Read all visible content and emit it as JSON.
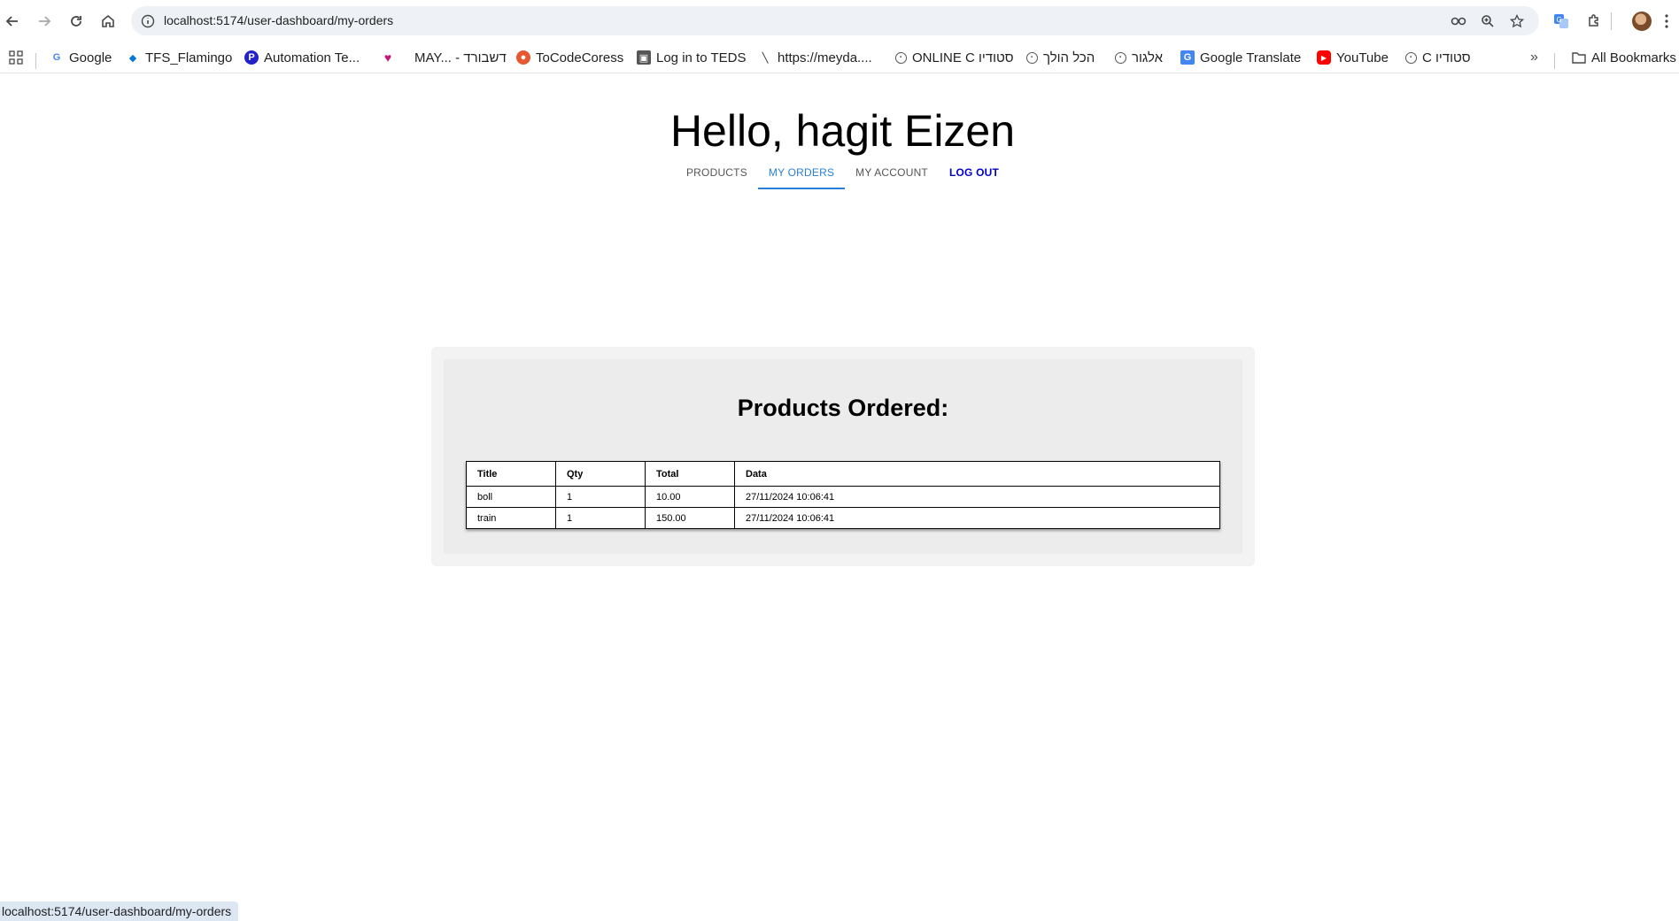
{
  "browser": {
    "url": "localhost:5174/user-dashboard/my-orders",
    "bookmarks": [
      {
        "label": "Google",
        "icon": "google-icon",
        "color": "#4285f4"
      },
      {
        "label": "TFS_Flamingo",
        "icon": "azure-devops-icon",
        "color": "#0078d4"
      },
      {
        "label": "Automation Te...",
        "icon": "p-icon",
        "color": "#2222cc"
      },
      {
        "label": "MAY... - דשבורד",
        "icon": "heart-icon",
        "color": "#c2187a"
      },
      {
        "label": "ToCodeCoress",
        "icon": "tocode-icon",
        "color": "#e8572f"
      },
      {
        "label": "Log in to TEDS",
        "icon": "teds-icon",
        "color": "#555555"
      },
      {
        "label": "https://meyda....",
        "icon": "meyda-icon",
        "color": "#222222"
      },
      {
        "label": "ONLINE C סטודיו",
        "icon": "globe-icon",
        "color": "#555555"
      },
      {
        "label": "הכל הולך",
        "icon": "globe-icon",
        "color": "#555555"
      },
      {
        "label": "אלגור",
        "icon": "globe-icon",
        "color": "#555555"
      },
      {
        "label": "Google Translate",
        "icon": "translate-icon",
        "color": "#4285f4"
      },
      {
        "label": "YouTube",
        "icon": "youtube-icon",
        "color": "#ff0000"
      },
      {
        "label": "C סטודיו",
        "icon": "globe-icon",
        "color": "#555555"
      }
    ],
    "all_bookmarks": "All Bookmarks",
    "status_url": "localhost:5174/user-dashboard/my-orders"
  },
  "page": {
    "greeting": "Hello, hagit Eizen",
    "nav": {
      "products": "PRODUCTS",
      "my_orders": "MY ORDERS",
      "my_account": "MY ACCOUNT",
      "logout": "LOG OUT"
    },
    "orders": {
      "title": "Products Ordered:",
      "columns": [
        "Title",
        "Qty",
        "Total",
        "Data"
      ],
      "rows": [
        [
          "boll",
          "1",
          "10.00",
          "27/11/2024 10:06:41"
        ],
        [
          "train",
          "1",
          "150.00",
          "27/11/2024 10:06:41"
        ]
      ]
    }
  },
  "colors": {
    "active_tab": "#2a7fd6",
    "logout": "#0000cc"
  }
}
